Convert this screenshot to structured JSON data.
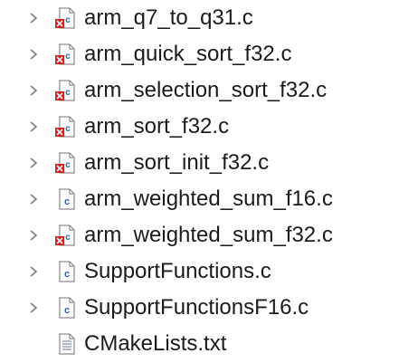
{
  "tree": {
    "items": [
      {
        "name": "arm_q7_to_q31.c",
        "icon": "c-source-file-error-icon",
        "expandable": true
      },
      {
        "name": "arm_quick_sort_f32.c",
        "icon": "c-source-file-error-icon",
        "expandable": true
      },
      {
        "name": "arm_selection_sort_f32.c",
        "icon": "c-source-file-error-icon",
        "expandable": true
      },
      {
        "name": "arm_sort_f32.c",
        "icon": "c-source-file-error-icon",
        "expandable": true
      },
      {
        "name": "arm_sort_init_f32.c",
        "icon": "c-source-file-error-icon",
        "expandable": true
      },
      {
        "name": "arm_weighted_sum_f16.c",
        "icon": "c-source-file-icon",
        "expandable": true
      },
      {
        "name": "arm_weighted_sum_f32.c",
        "icon": "c-source-file-error-icon",
        "expandable": true
      },
      {
        "name": "SupportFunctions.c",
        "icon": "c-source-file-icon",
        "expandable": true
      },
      {
        "name": "SupportFunctionsF16.c",
        "icon": "c-source-file-icon",
        "expandable": true
      },
      {
        "name": "CMakeLists.txt",
        "icon": "text-file-icon",
        "expandable": false
      }
    ]
  },
  "colors": {
    "chevron": "#7a7a7a",
    "error": "#d0201b",
    "c_badge": "#2d5db1",
    "text": "#1b1b1b"
  }
}
